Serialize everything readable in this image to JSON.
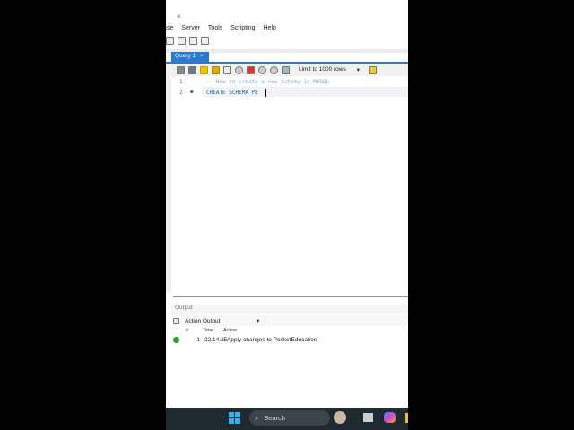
{
  "window": {
    "tab_fragment": "...",
    "tab_close": "×"
  },
  "menu": [
    "ase",
    "Server",
    "Tools",
    "Scripting",
    "Help"
  ],
  "query_tab": {
    "label": "Query 1",
    "close": "×"
  },
  "toolbar": {
    "limit": "Limit to 1000 rows",
    "limit_arrow": "▾"
  },
  "editor": {
    "lines": [
      {
        "num": "1",
        "text": "-- How to create a new schema in MYSQL"
      },
      {
        "num": "2",
        "marker": "●",
        "text": "CREATE SCHEMA PE"
      }
    ]
  },
  "output": {
    "title": "Output",
    "selector": "Action Output",
    "selector_arrow": "▾",
    "columns": [
      "#",
      "Time",
      "Action"
    ],
    "rows": [
      {
        "num": "1",
        "time": "22:14:25",
        "action": "Apply changes to PocketEducation",
        "status": "success"
      }
    ]
  },
  "taskbar": {
    "search": "Search"
  },
  "colors": {
    "accent": "#2a7ad1",
    "success": "#2aa52a",
    "comment": "#7aa2c8",
    "keyword": "#1f5fa8"
  }
}
